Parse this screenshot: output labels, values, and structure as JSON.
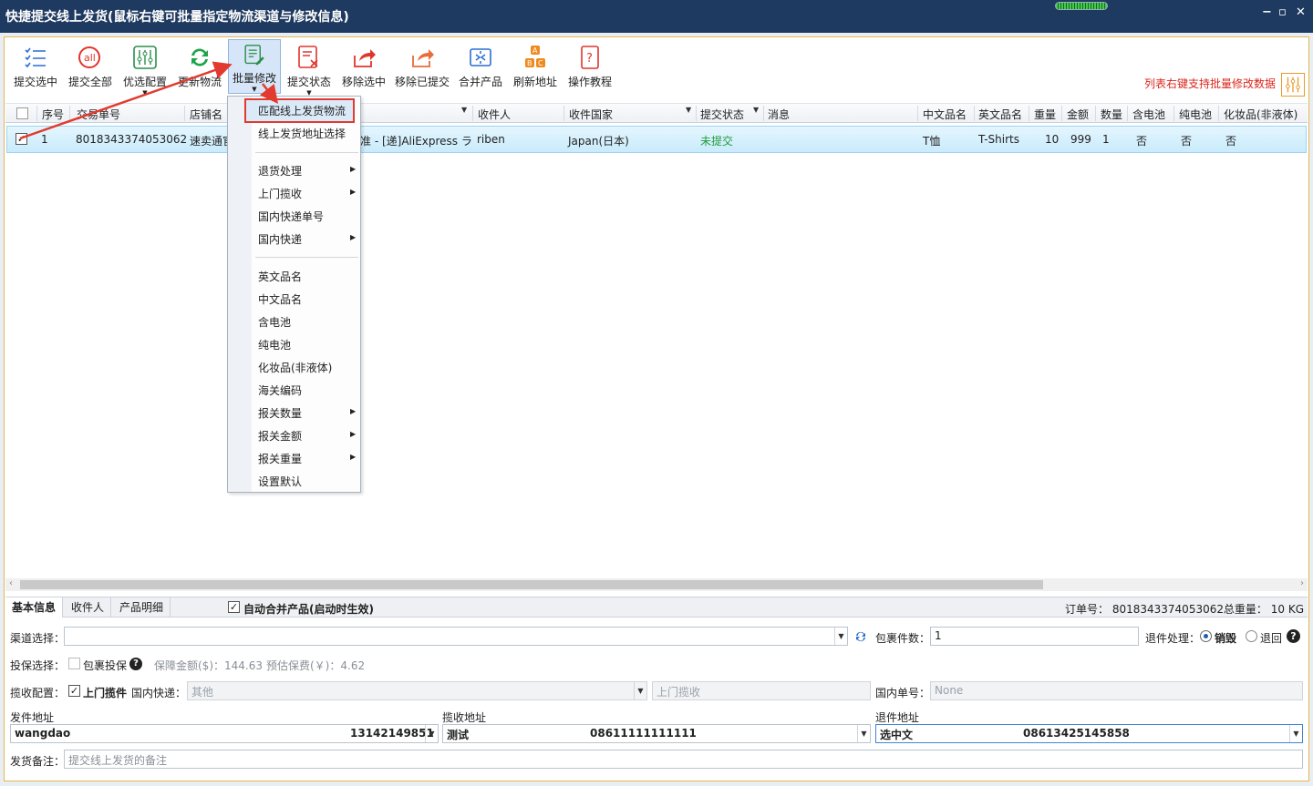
{
  "window": {
    "title": "快捷提交线上发货(鼠标右键可批量指定物流渠道与修改信息)",
    "min_glyph": "−",
    "restore_glyph": "▫",
    "close_glyph": "✕"
  },
  "toolbar": {
    "buttons": [
      {
        "label": "提交选中",
        "icon": "checklist-icon"
      },
      {
        "label": "提交全部",
        "icon": "at-all-icon"
      },
      {
        "label": "优选配置",
        "icon": "sliders-icon"
      },
      {
        "label": "更新物流",
        "icon": "refresh-icon"
      },
      {
        "label": "批量修改",
        "icon": "batch-edit-icon"
      },
      {
        "label": "提交状态",
        "icon": "status-x-icon"
      },
      {
        "label": "移除选中",
        "icon": "remove-share-icon"
      },
      {
        "label": "移除已提交",
        "icon": "remove-submitted-icon"
      },
      {
        "label": "合并产品",
        "icon": "merge-icon"
      },
      {
        "label": "刷新地址",
        "icon": "abc-refresh-icon"
      },
      {
        "label": "操作教程",
        "icon": "help-doc-icon"
      }
    ],
    "hint": "列表右键支持批量修改数据"
  },
  "table": {
    "columns": [
      "序号",
      "交易单号",
      "店铺名",
      "收件人",
      "收件国家",
      "提交状态",
      "消息",
      "中文品名",
      "英文品名",
      "重量",
      "金额",
      "数量",
      "含电池",
      "纯电池",
      "化妆品(非液体)"
    ],
    "row": {
      "checked": "✓",
      "index": "1",
      "trade_no": "8018343374053062",
      "shop": "速卖通官",
      "logistics": "准 - [递]AliExpress ラ",
      "recipient": "riben",
      "country": "Japan(日本)",
      "status": "未提交",
      "message": "",
      "cn_name": "T恤",
      "en_name": "T-Shirts",
      "weight": "10",
      "amount": "999",
      "qty": "1",
      "battery": "否",
      "pure_battery": "否",
      "cosmetics": "否"
    }
  },
  "context_menu": {
    "items": [
      {
        "label": "匹配线上发货物流",
        "sub": false
      },
      {
        "label": "线上发货地址选择",
        "sub": false
      },
      {
        "label": "退货处理",
        "sub": true
      },
      {
        "label": "上门揽收",
        "sub": true
      },
      {
        "label": "国内快递单号",
        "sub": false
      },
      {
        "label": "国内快递",
        "sub": true
      },
      {
        "label": "英文品名",
        "sub": false
      },
      {
        "label": "中文品名",
        "sub": false
      },
      {
        "label": "含电池",
        "sub": false
      },
      {
        "label": "纯电池",
        "sub": false
      },
      {
        "label": "化妆品(非液体)",
        "sub": false
      },
      {
        "label": "海关编码",
        "sub": false
      },
      {
        "label": "报关数量",
        "sub": true
      },
      {
        "label": "报关金额",
        "sub": true
      },
      {
        "label": "报关重量",
        "sub": true
      },
      {
        "label": "设置默认",
        "sub": false
      }
    ]
  },
  "bottom": {
    "tabs": [
      "基本信息",
      "收件人",
      "产品明细"
    ],
    "auto_merge": "自动合并产品(启动时生效)",
    "order_no": "订单号： 8018343374053062",
    "total_weight": "总重量： 10 KG",
    "channel_label": "渠道选择：",
    "channel_value": "",
    "package_label": "包裹件数：",
    "package_value": "1",
    "return_label": "退件处理：",
    "return_destroy": "销毁",
    "return_back": "退回",
    "insure_label": "投保选择：",
    "insure_check": "包裹投保",
    "insure_amount": "保障金额($)：144.63",
    "insure_fee": "预估保费(￥)：4.62",
    "pickup_label": "揽收配置：",
    "pickup_check": "上门揽件",
    "domestic_label": "国内快递：",
    "domestic_value": "其他",
    "pickup_value": "上门揽收",
    "domestic_no_label": "国内单号：",
    "domestic_no_value": "None",
    "sender_label": "发件地址",
    "sender_name": "wangdao",
    "sender_phone": "13142149851",
    "pickup_addr_label": "揽收地址",
    "pickup_addr_name": "测试",
    "pickup_addr_phone": "08611111111111",
    "return_addr_label": "退件地址",
    "return_addr_name": "选中文",
    "return_addr_phone": "08613425145858",
    "remark_label": "发货备注：",
    "remark_placeholder": "提交线上发货的备注"
  }
}
